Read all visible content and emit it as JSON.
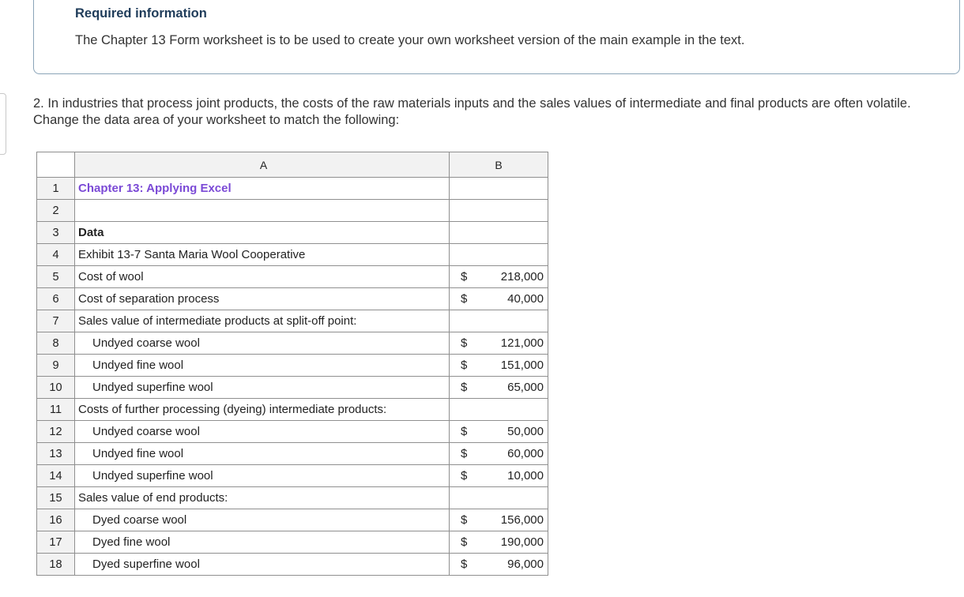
{
  "info": {
    "title": "Required information",
    "text": "The Chapter 13 Form worksheet is to be used to create your own worksheet version of the main example in the text."
  },
  "question": "2. In industries that process joint products, the costs of the raw materials inputs and the sales values of intermediate and final products are often volatile. Change the data area of your worksheet to match the following:",
  "sheet": {
    "col_a": "A",
    "col_b": "B",
    "rows": [
      {
        "num": "1",
        "label": "Chapter 13: Applying Excel",
        "currency": "",
        "value": ""
      },
      {
        "num": "2",
        "label": "",
        "currency": "",
        "value": ""
      },
      {
        "num": "3",
        "label": "Data",
        "currency": "",
        "value": ""
      },
      {
        "num": "4",
        "label": "Exhibit 13-7 Santa Maria Wool Cooperative",
        "currency": "",
        "value": ""
      },
      {
        "num": "5",
        "label": "Cost of wool",
        "currency": "$",
        "value": "218,000"
      },
      {
        "num": "6",
        "label": "Cost of separation process",
        "currency": "$",
        "value": "40,000"
      },
      {
        "num": "7",
        "label": "Sales value of intermediate products at split-off point:",
        "currency": "",
        "value": ""
      },
      {
        "num": "8",
        "label": "Undyed coarse wool",
        "currency": "$",
        "value": "121,000"
      },
      {
        "num": "9",
        "label": "Undyed fine wool",
        "currency": "$",
        "value": "151,000"
      },
      {
        "num": "10",
        "label": "Undyed superfine wool",
        "currency": "$",
        "value": "65,000"
      },
      {
        "num": "11",
        "label": "Costs of further processing (dyeing) intermediate products:",
        "currency": "",
        "value": ""
      },
      {
        "num": "12",
        "label": "Undyed coarse wool",
        "currency": "$",
        "value": "50,000"
      },
      {
        "num": "13",
        "label": "Undyed fine wool",
        "currency": "$",
        "value": "60,000"
      },
      {
        "num": "14",
        "label": "Undyed superfine wool",
        "currency": "$",
        "value": "10,000"
      },
      {
        "num": "15",
        "label": "Sales value of end products:",
        "currency": "",
        "value": ""
      },
      {
        "num": "16",
        "label": "Dyed coarse wool",
        "currency": "$",
        "value": "156,000"
      },
      {
        "num": "17",
        "label": "Dyed fine wool",
        "currency": "$",
        "value": "190,000"
      },
      {
        "num": "18",
        "label": "Dyed superfine wool",
        "currency": "$",
        "value": "96,000"
      }
    ]
  }
}
